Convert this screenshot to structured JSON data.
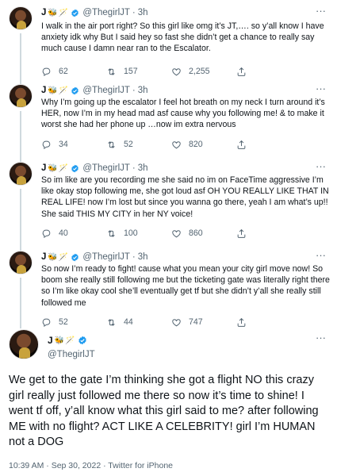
{
  "author": {
    "name": "J",
    "emoji": "🐝🪄",
    "handle": "@ThegirlJT"
  },
  "tweets": [
    {
      "time": "3h",
      "text": "I walk in the air port right? So this girl like omg it’s JT,…. so y’all know I have anxiety idk why But I said hey so fast she didn’t get a chance to really say much cause I damn near ran to the Escalator.",
      "replies": "62",
      "retweets": "157",
      "likes": "2,255"
    },
    {
      "time": "3h",
      "text": "Why I’m going up the escalator I feel hot breath on my neck I turn around it’s HER, now I’m in my head mad asf cause why you following me! & to make it worst she had her phone up …now im extra nervous",
      "replies": "34",
      "retweets": "52",
      "likes": "820"
    },
    {
      "time": "3h",
      "text": "So im like are you recording me she said no im on FaceTime aggressive I’m like okay stop following me, she got loud asf OH YOU REALLY LIKE THAT IN REAL LIFE! now I’m lost but since you wanna go there, yeah I am what’s up!! She said THIS MY CITY in her NY voice!",
      "replies": "40",
      "retweets": "100",
      "likes": "860"
    },
    {
      "time": "3h",
      "text": "So now I’m ready to fight! cause what you mean your city girl move now! So boom she really still following me but the ticketing gate was literally right there so I’m like okay cool she’ll eventually get tf but she didn’t y’all she really still followed me",
      "replies": "52",
      "retweets": "44",
      "likes": "747"
    }
  ],
  "main_tweet": {
    "text": "We get to the gate I’m thinking she got a flight NO this crazy girl really just followed me there so now it’s time to shine! I went tf off, y’all know what this girl said to me? after following ME with no flight? ACT LIKE A CELEBRITY! girl I’m HUMAN not a DOG",
    "timestamp": "10:39 AM · Sep 30, 2022 · Twitter for iPhone"
  },
  "ui": {
    "dot_separator": "·",
    "more_glyph": "···",
    "accent_color": "#1d9bf0",
    "icons": [
      "verified-badge-icon",
      "reply-icon",
      "retweet-icon",
      "like-icon",
      "share-icon",
      "more-icon"
    ]
  }
}
